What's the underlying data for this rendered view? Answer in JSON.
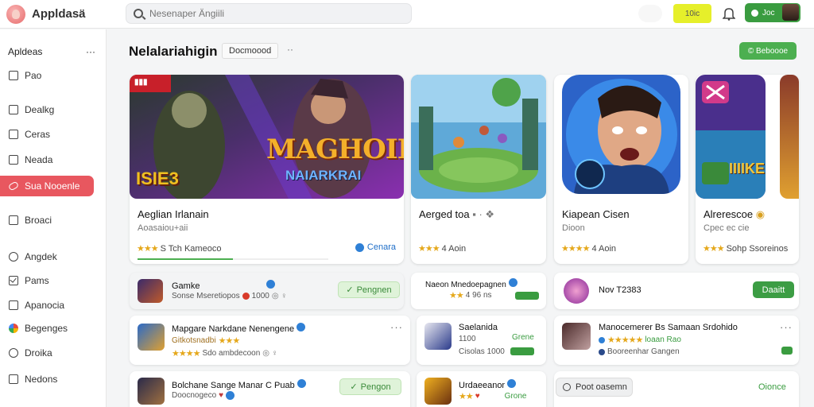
{
  "app": {
    "name": "Appldasä"
  },
  "search": {
    "placeholder": "Nesenaper Ängiili"
  },
  "topbar": {
    "yellow_label": "10ic",
    "account_label": "Joc"
  },
  "sidebar": {
    "header": "Apldeas",
    "more": "···",
    "items": [
      {
        "label": "Pao",
        "icon": "square-icon"
      },
      {
        "label": "Dealkg",
        "icon": "box-icon"
      },
      {
        "label": "Ceras",
        "icon": "box-icon"
      },
      {
        "label": "Neada",
        "icon": "box-icon"
      },
      {
        "label": "Sua Nooenle",
        "icon": "pencil-icon",
        "active": true
      },
      {
        "label": "Broaci",
        "icon": "box-icon"
      },
      {
        "label": "Angdek",
        "icon": "circle-icon"
      },
      {
        "label": "Pams",
        "icon": "check-icon"
      },
      {
        "label": "Apanocia",
        "icon": "bank-icon"
      },
      {
        "label": "Begenges",
        "icon": "multicolor-icon"
      },
      {
        "label": "Droika",
        "icon": "circle-icon"
      },
      {
        "label": "Nedons",
        "icon": "box-icon"
      }
    ]
  },
  "main": {
    "title": "Nelalariahigin",
    "filter": "Docmoood",
    "filter_more": "··",
    "action_label": "© Beboooe"
  },
  "featured": [
    {
      "title": "Aeglian Irlanain",
      "subtitle": "Aoasaiou+aii",
      "stars": "★★★",
      "rating": "S Tch Kameoco",
      "tag": "Cenara",
      "progress": 0.5,
      "art_text_1": "MAGHOII",
      "art_text_2": "NAIARKRAI",
      "art_corner": "ISIE3"
    },
    {
      "title": "Aerged toa",
      "subtitle": "",
      "stars": "★★★",
      "rating": "4 Aoin",
      "tag": ""
    },
    {
      "title": "Kiapean Cisen",
      "subtitle": "Dioon",
      "stars": "★★★★",
      "rating": "4 Aoin",
      "tag": ""
    },
    {
      "title": "Alrerescoe",
      "subtitle": "Cpec  ec cie",
      "stars": "★★★",
      "rating": "Sohp Ssoreinos",
      "tag": "",
      "art_text": "IIIIKE"
    }
  ],
  "rows": [
    {
      "title": "Gamke",
      "meta": "Sonse Mseretiopos",
      "count": "1000",
      "button": "Pengnen"
    },
    {
      "title": "Naeon Mnedoepagnen",
      "meta": "4 96 ns",
      "button": ""
    },
    {
      "title": "Nov T2383",
      "button": "Daaitt"
    },
    {
      "title": "Mapgare Narkdane Nenengene",
      "meta": "Gitkotsnadbi",
      "rating": "Sdo ambdecoon",
      "button": ""
    },
    {
      "title": "Saelanida",
      "meta": "1100",
      "rating": "Cisolas 1000",
      "button": "Grene"
    },
    {
      "title": "Manocemerer",
      "meta": "Bs Samaan Srdohido",
      "rating": "loaan Rao",
      "sub": "Booreenhar Gangen",
      "button": ""
    },
    {
      "title": "Bolchane Sange Manar C Puab",
      "meta": "Doocnogeco",
      "button": "Pengon"
    },
    {
      "title": "Urdaeeanor",
      "meta": "Grone",
      "button": ""
    },
    {
      "title": "Poot oasemn",
      "button": "Oionce"
    }
  ]
}
